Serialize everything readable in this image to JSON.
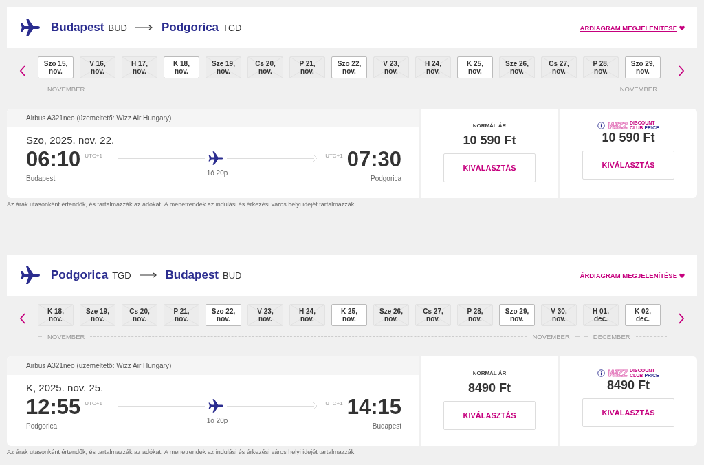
{
  "legs": [
    {
      "origin": {
        "city": "Budapest",
        "code": "BUD"
      },
      "destination": {
        "city": "Podgorica",
        "code": "TGD"
      },
      "chart_link": "ÁRDIAGRAM MEGJELENÍTÉSE",
      "dates": [
        {
          "day": "Szo 15,",
          "month": "nov.",
          "available": true
        },
        {
          "day": "V 16,",
          "month": "nov.",
          "available": false
        },
        {
          "day": "H 17,",
          "month": "nov.",
          "available": false
        },
        {
          "day": "K 18,",
          "month": "nov.",
          "available": true
        },
        {
          "day": "Sze 19,",
          "month": "nov.",
          "available": false
        },
        {
          "day": "Cs 20,",
          "month": "nov.",
          "available": false
        },
        {
          "day": "P 21,",
          "month": "nov.",
          "available": false
        },
        {
          "day": "Szo 22,",
          "month": "nov.",
          "available": true
        },
        {
          "day": "V 23,",
          "month": "nov.",
          "available": false
        },
        {
          "day": "H 24,",
          "month": "nov.",
          "available": false
        },
        {
          "day": "K 25,",
          "month": "nov.",
          "available": true
        },
        {
          "day": "Sze 26,",
          "month": "nov.",
          "available": false
        },
        {
          "day": "Cs 27,",
          "month": "nov.",
          "available": false
        },
        {
          "day": "P 28,",
          "month": "nov.",
          "available": false
        },
        {
          "day": "Szo 29,",
          "month": "nov.",
          "available": true
        }
      ],
      "months": [
        {
          "start": "NOVEMBER",
          "end": "NOVEMBER"
        }
      ],
      "flight": {
        "aircraft": "Airbus A321neo (üzemeltető: Wizz Air Hungary)",
        "date": "Szo, 2025. nov. 22.",
        "departure": "06:10",
        "departure_tz": "UTC+1",
        "departure_city": "Budapest",
        "arrival": "07:30",
        "arrival_tz": "UTC+1",
        "arrival_city": "Podgorica",
        "duration": "1ó 20p"
      },
      "fares": [
        {
          "kind": "normal",
          "label": "NORMÁL ÁR",
          "price": "10 590 Ft",
          "button": "KIVÁLASZTÁS"
        },
        {
          "kind": "club",
          "brand": "WIZZ",
          "top": "DISCOUNT",
          "club": "CLUB",
          "price_word": "PRICE",
          "price": "10 590 Ft",
          "button": "KIVÁLASZTÁS"
        }
      ],
      "note": "Az árak utasonként értendők, és tartalmazzák az adókat. A menetrendek az indulási és érkezési város helyi idejét tartalmazzák."
    },
    {
      "origin": {
        "city": "Podgorica",
        "code": "TGD"
      },
      "destination": {
        "city": "Budapest",
        "code": "BUD"
      },
      "chart_link": "ÁRDIAGRAM MEGJELENÍTÉSE",
      "dates": [
        {
          "day": "K 18,",
          "month": "nov.",
          "available": false
        },
        {
          "day": "Sze 19,",
          "month": "nov.",
          "available": false
        },
        {
          "day": "Cs 20,",
          "month": "nov.",
          "available": false
        },
        {
          "day": "P 21,",
          "month": "nov.",
          "available": false
        },
        {
          "day": "Szo 22,",
          "month": "nov.",
          "available": true
        },
        {
          "day": "V 23,",
          "month": "nov.",
          "available": false
        },
        {
          "day": "H 24,",
          "month": "nov.",
          "available": false
        },
        {
          "day": "K 25,",
          "month": "nov.",
          "available": true
        },
        {
          "day": "Sze 26,",
          "month": "nov.",
          "available": false
        },
        {
          "day": "Cs 27,",
          "month": "nov.",
          "available": false
        },
        {
          "day": "P 28,",
          "month": "nov.",
          "available": false
        },
        {
          "day": "Szo 29,",
          "month": "nov.",
          "available": true
        },
        {
          "day": "V 30,",
          "month": "nov.",
          "available": false
        },
        {
          "day": "H 01,",
          "month": "dec.",
          "available": false
        },
        {
          "day": "K 02,",
          "month": "dec.",
          "available": true
        }
      ],
      "months": [
        {
          "start": "NOVEMBER",
          "end": "NOVEMBER"
        },
        {
          "start": "DECEMBER"
        }
      ],
      "flight": {
        "aircraft": "Airbus A321neo (üzemeltető: Wizz Air Hungary)",
        "date": "K, 2025. nov. 25.",
        "departure": "12:55",
        "departure_tz": "UTC+1",
        "departure_city": "Podgorica",
        "arrival": "14:15",
        "arrival_tz": "UTC+1",
        "arrival_city": "Budapest",
        "duration": "1ó 20p"
      },
      "fares": [
        {
          "kind": "normal",
          "label": "NORMÁL ÁR",
          "price": "8490 Ft",
          "button": "KIVÁLASZTÁS"
        },
        {
          "kind": "club",
          "brand": "WIZZ",
          "top": "DISCOUNT",
          "club": "CLUB",
          "price_word": "PRICE",
          "price": "8490 Ft",
          "button": "KIVÁLASZTÁS"
        }
      ],
      "note": "Az árak utasonként értendők, és tartalmazzák az adókat. A menetrendek az indulási és érkezési város helyi idejét tartalmazzák."
    }
  ]
}
